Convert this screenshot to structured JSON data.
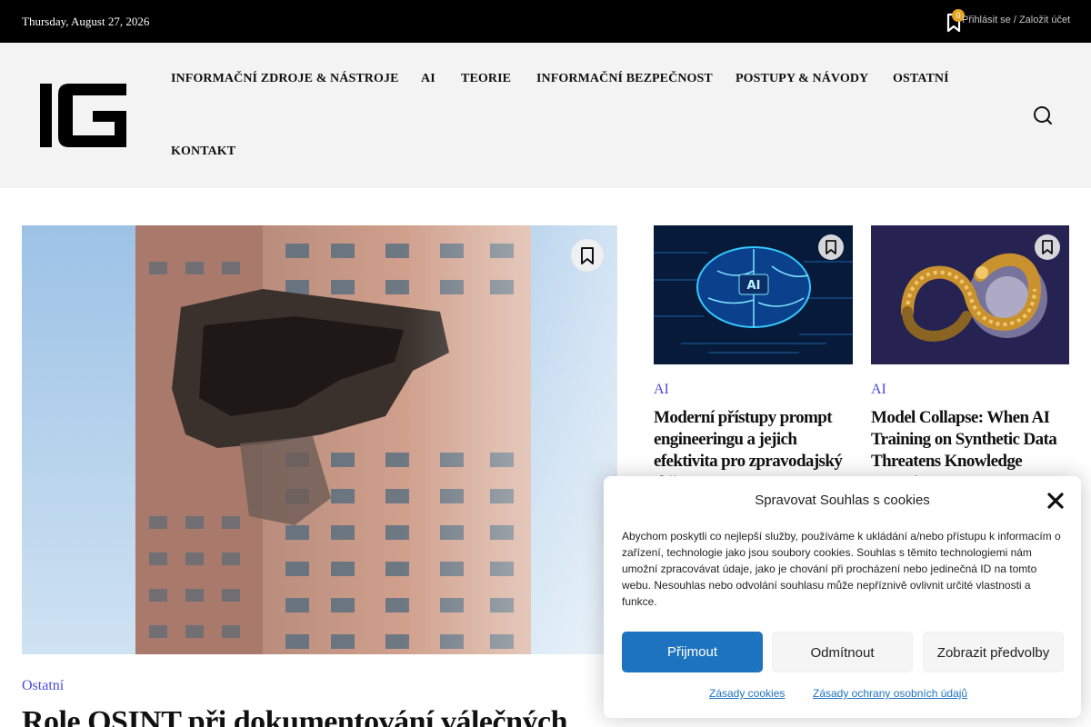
{
  "topbar": {
    "date": "Thursday, August 27, 2026",
    "bookmark_count": "0",
    "login_text": "Přihlásit se / Založit účet"
  },
  "header": {
    "logo_text": "IG",
    "nav": [
      "INFORMAČNÍ ZDROJE & NÁSTROJE",
      "AI",
      "TEORIE",
      "INFORMAČNÍ BEZPEČNOST",
      "POSTUPY & NÁVODY",
      "OSTATNÍ",
      "KONTAKT"
    ]
  },
  "feature": {
    "category": "Ostatní",
    "title": "Role OSINT při dokumentování válečných"
  },
  "cards": [
    {
      "category": "AI",
      "title": "Moderní přístupy prompt engineeringu a jejich efektivita pro zpravodajský sběr"
    },
    {
      "category": "AI",
      "title": "Model Collapse: When AI Training on Synthetic Data Threatens Knowledge Integrity"
    }
  ],
  "cookie": {
    "title": "Spravovat Souhlas s cookies",
    "text": "Abychom poskytli co nejlepší služby, používáme k ukládání a/nebo přístupu k informacím o zařízení, technologie jako jsou soubory cookies. Souhlas s těmito technologiemi nám umožní zpracovávat údaje, jako je chování při procházení nebo jedinečná ID na tomto webu. Nesouhlas nebo odvolání souhlasu může nepříznivě ovlivnit určité vlastnosti a funkce.",
    "accept_label": "Přijmout",
    "deny_label": "Odmítnout",
    "prefs_label": "Zobrazit předvolby",
    "link_cookies": "Zásady cookies",
    "link_privacy": "Zásady ochrany osobních údajů"
  },
  "colors": {
    "accent": "#1e73be",
    "category": "#4a4ad8",
    "badge": "#e5a41f"
  }
}
